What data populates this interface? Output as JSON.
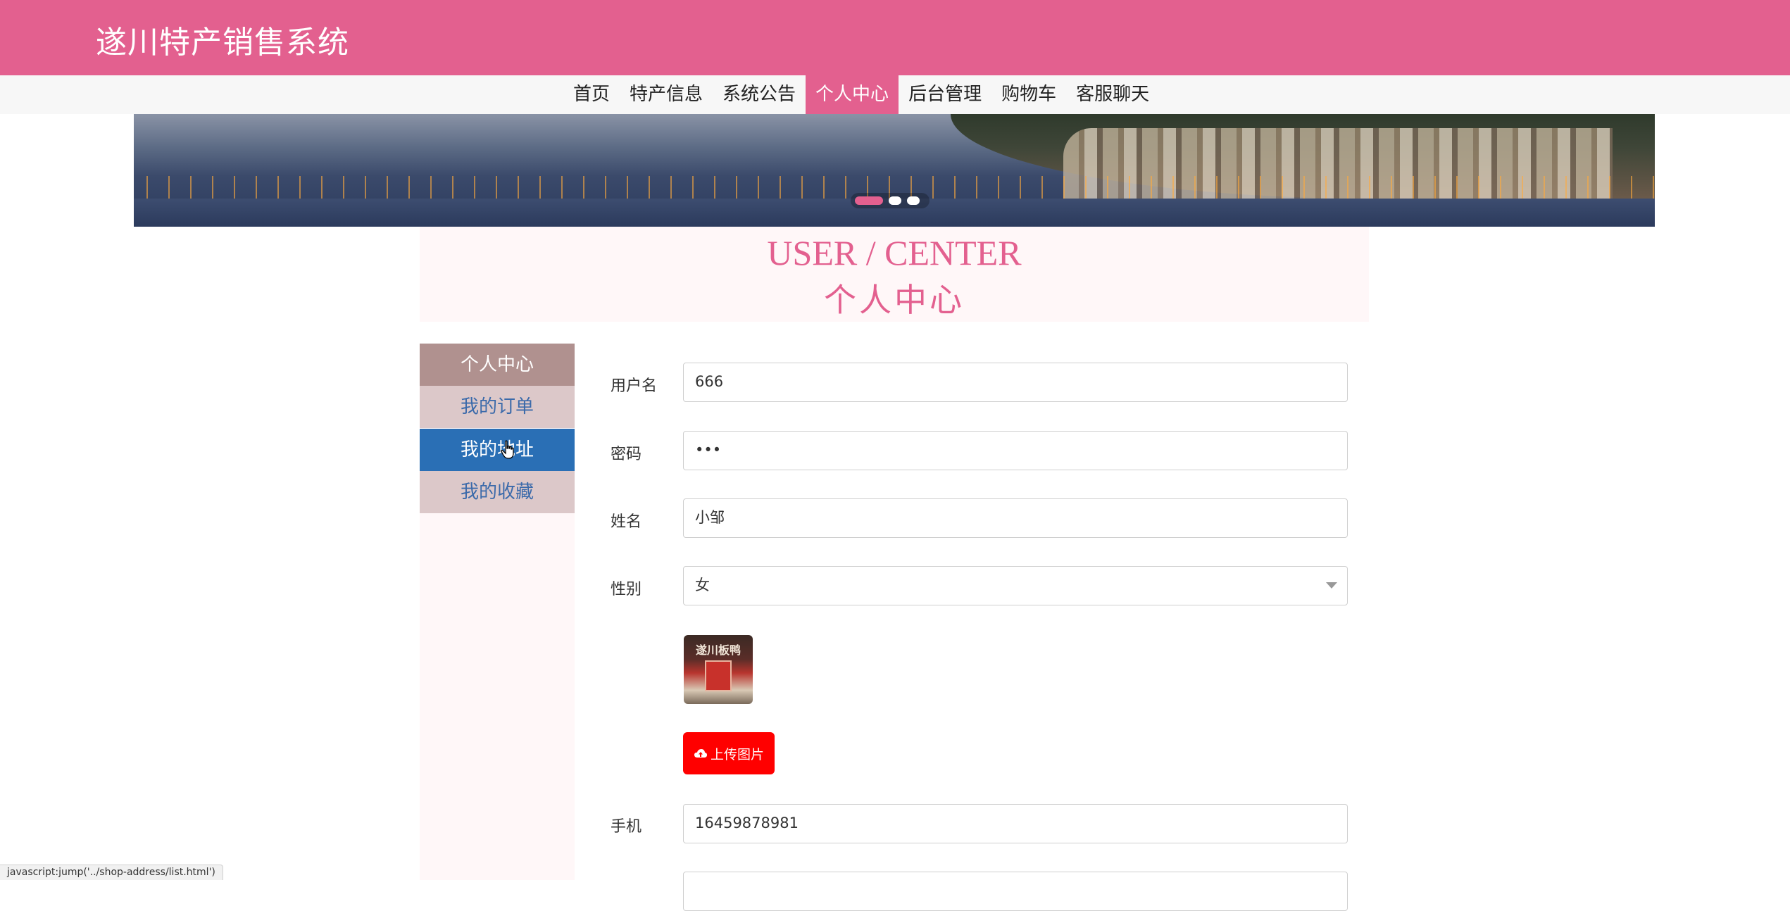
{
  "header": {
    "title": "遂川特产销售系统"
  },
  "nav": {
    "items": [
      "首页",
      "特产信息",
      "系统公告",
      "个人中心",
      "后台管理",
      "购物车",
      "客服聊天"
    ],
    "active": "个人中心"
  },
  "banner": {
    "slides": 3,
    "active_slide": 1
  },
  "section": {
    "title_en": "USER / CENTER",
    "title_cn": "个人中心"
  },
  "sidebar": {
    "items": [
      {
        "label": "个人中心"
      },
      {
        "label": "我的订单"
      },
      {
        "label": "我的地址"
      },
      {
        "label": "我的收藏"
      }
    ],
    "hovered": "我的地址"
  },
  "form": {
    "username": {
      "label": "用户名",
      "value": "666"
    },
    "password": {
      "label": "密码",
      "value": "•••"
    },
    "name": {
      "label": "姓名",
      "value": "小邹"
    },
    "gender": {
      "label": "性别",
      "value": "女"
    },
    "avatar": {
      "caption": "遂川板鸭"
    },
    "upload_label": "上传图片",
    "phone": {
      "label": "手机",
      "value": "16459878981"
    }
  },
  "status_bar": {
    "text": "javascript:jump('../shop-address/list.html')"
  },
  "colors": {
    "brand": "#e3608f",
    "active_side": "#2a6fb5",
    "upload": "#ff0000"
  }
}
